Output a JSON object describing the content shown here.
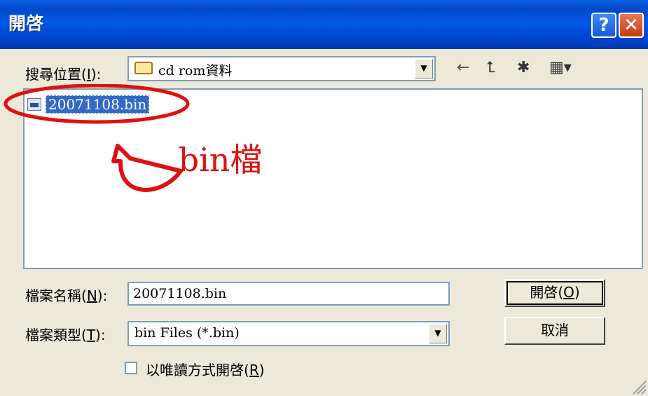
{
  "window": {
    "title": "開啓",
    "help_label": "?",
    "close_label": "✕"
  },
  "look_in": {
    "label": "搜尋位置",
    "accel": "I",
    "suffix": "):",
    "paren": "(",
    "value": "cd rom資料"
  },
  "toolbar": {
    "back_icon": "←",
    "up_icon": "⮤",
    "new_folder_icon": "✱",
    "view_icon": "▦▾"
  },
  "files": [
    {
      "name": "20071108.bin"
    }
  ],
  "annotation": {
    "text": ".bin檔",
    "color": "#e01010"
  },
  "filename": {
    "label": "檔案名稱",
    "accel": "N",
    "paren": "(",
    "suffix": "):",
    "value": "20071108.bin"
  },
  "filetype": {
    "label": "檔案類型",
    "accel": "T",
    "paren": "(",
    "suffix": "):",
    "value": "bin Files (*.bin)"
  },
  "readonly": {
    "label": "以唯讀方式開啓",
    "accel": "R",
    "paren": "(",
    "suffix": ")"
  },
  "buttons": {
    "open_label": "開啓",
    "open_accel": "O",
    "cancel_label": "取消"
  },
  "colors": {
    "titlebar": "#0348c8",
    "selection": "#316ac5",
    "annotation": "#e01010"
  }
}
